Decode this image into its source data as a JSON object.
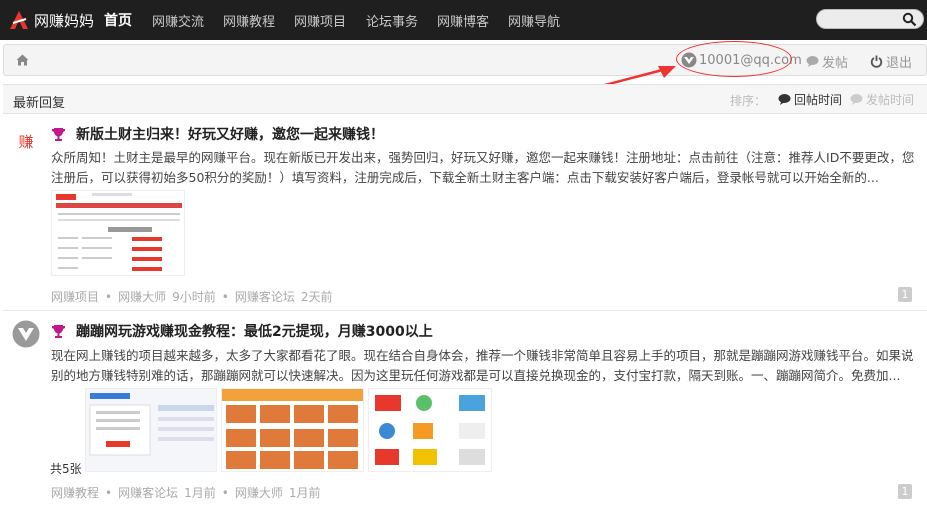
{
  "nav": {
    "logo_text": "网赚妈妈",
    "items": [
      "首页",
      "网赚交流",
      "网赚教程",
      "网赚项目",
      "论坛事务",
      "网赚博客",
      "网赚导航"
    ],
    "search_placeholder": ""
  },
  "crumb": {
    "user_email": "10001@qq.com",
    "post_label": "发帖",
    "logout_label": "退出"
  },
  "section": {
    "title": "最新回复",
    "sort_label": "排序：",
    "sort_reply": "回帖时间",
    "sort_post": "发帖时间"
  },
  "threads": [
    {
      "avatar_text": "赚",
      "title": "新版土财主归来！好玩又好赚，邀您一起来赚钱！",
      "excerpt": "众所周知！土财主是最早的网赚平台。现在新版已开发出来，强势回归，好玩又好赚，邀您一起来赚钱！注册地址：点击前往（注意：推荐人ID不要更改，您注册后，可以获得初始多50积分的奖励！）填写资料，注册完成后，下载全新土财主客户端：点击下载安装好客户端后，登录帐号就可以开始全新的...",
      "meta": [
        "网赚项目",
        "•",
        "网赚大师",
        "9小时前",
        "•",
        "网赚客论坛",
        "2天前"
      ],
      "count": "1"
    },
    {
      "title": "蹦蹦网玩游戏赚现金教程：最低2元提现，月赚3000以上",
      "excerpt": "现在网上赚钱的项目越来越多，太多了大家都看花了眼。现在结合自身体会，推荐一个赚钱非常简单且容易上手的项目，那就是蹦蹦网游戏赚钱平台。如果说别的地方赚钱特别难的话，那蹦蹦网就可以快速解决。因为这里玩任何游戏都是可以直接兑换现金的，支付宝打款，隔天到账。一、蹦蹦网简介。免费加...",
      "images_label": "共5张",
      "meta": [
        "网赚教程",
        "•",
        "网赚客论坛",
        "1月前",
        "•",
        "网赚大师",
        "1月前"
      ],
      "count": "1"
    }
  ],
  "colors": {
    "nav_bg": "#1f1f1f",
    "accent_red": "#e33",
    "trophy": "#c2188a"
  }
}
